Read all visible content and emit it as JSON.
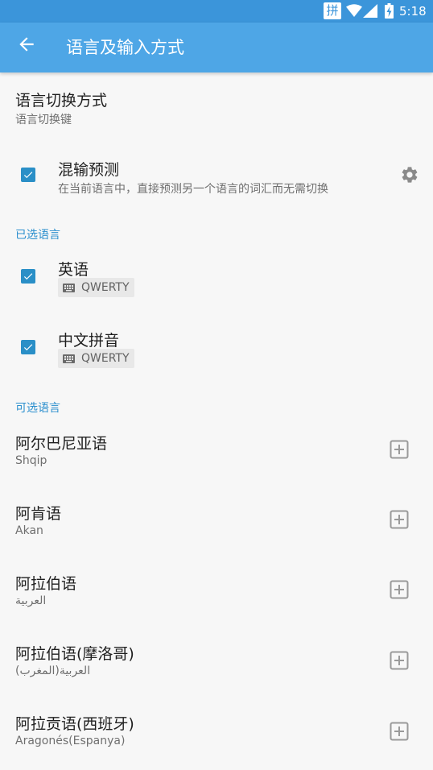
{
  "status_bar": {
    "ime_indicator": "拼",
    "time": "5:18",
    "icons": [
      "wifi-icon",
      "signal-icon",
      "battery-charging-icon"
    ]
  },
  "app_bar": {
    "title": "语言及输入方式",
    "back_icon": "arrow-left-icon"
  },
  "switch_method": {
    "title": "语言切换方式",
    "summary": "语言切换键"
  },
  "mixed_prediction": {
    "title": "混输预测",
    "summary": "在当前语言中，直接预测另一个语言的词汇而无需切换",
    "checked": true,
    "settings_icon": "gear-icon"
  },
  "selected_section": {
    "header": "已选语言",
    "items": [
      {
        "name": "英语",
        "layout": "QWERTY",
        "checked": true
      },
      {
        "name": "中文拼音",
        "layout": "QWERTY",
        "checked": true
      }
    ]
  },
  "available_section": {
    "header": "可选语言",
    "items": [
      {
        "name": "阿尔巴尼亚语",
        "native": "Shqip"
      },
      {
        "name": "阿肯语",
        "native": "Akan"
      },
      {
        "name": "阿拉伯语",
        "native": "العربية"
      },
      {
        "name": "阿拉伯语(摩洛哥)",
        "native": "العربية(المغرب)"
      },
      {
        "name": "阿拉贡语(西班牙)",
        "native": "Aragonés(Espanya)"
      }
    ]
  },
  "colors": {
    "app_bar": "#4ea6e6",
    "status_bar": "#3b95da",
    "accent": "#2a8fc7",
    "section_header": "#2b8fce",
    "background": "#f7f7f7"
  }
}
